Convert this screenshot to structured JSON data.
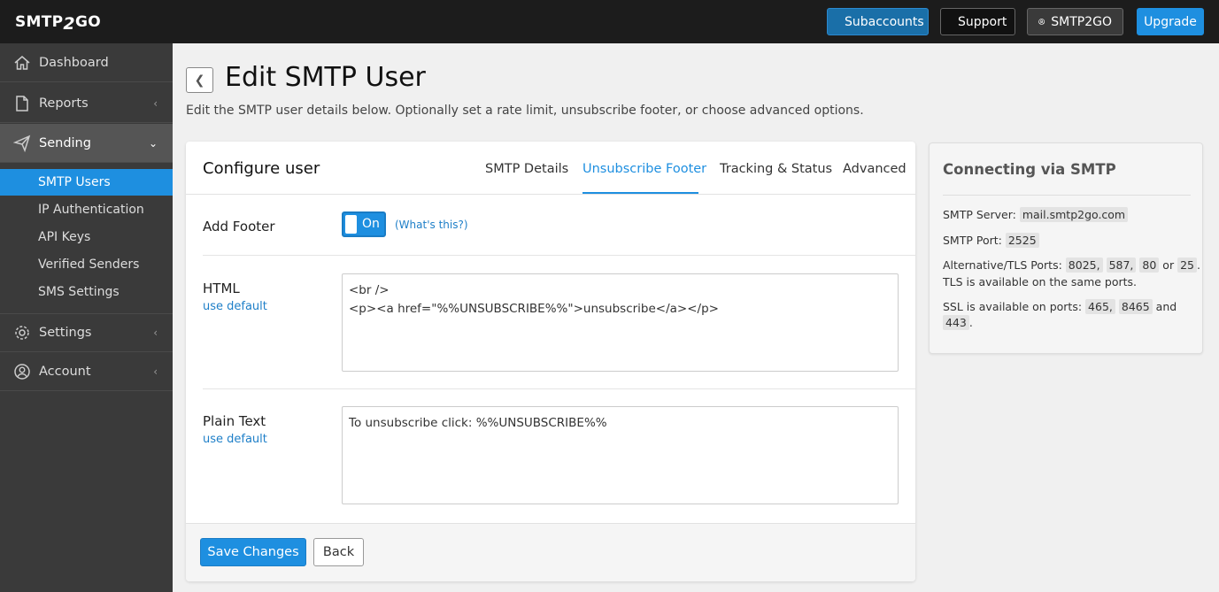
{
  "app": {
    "logo_prefix": "SMTP",
    "logo_two": "2",
    "logo_suffix": "GO"
  },
  "topbar": {
    "subaccounts": "Subaccounts",
    "support": "Support",
    "account": "SMTP2GO",
    "upgrade": "Upgrade"
  },
  "sidebar": {
    "dashboard": "Dashboard",
    "reports": "Reports",
    "sending": "Sending",
    "sending_sub": [
      "SMTP Users",
      "IP Authentication",
      "API Keys",
      "Verified Senders",
      "SMS Settings"
    ],
    "settings": "Settings",
    "account": "Account"
  },
  "page": {
    "title": "Edit SMTP User",
    "subtitle": "Edit the SMTP user details below. Optionally set a rate limit, unsubscribe footer, or choose advanced options."
  },
  "card": {
    "title": "Configure user",
    "tabs": [
      "SMTP Details",
      "Unsubscribe Footer",
      "Tracking & Status",
      "Advanced"
    ],
    "active_tab": "Unsubscribe Footer",
    "add_footer_label": "Add Footer",
    "toggle_label": "On",
    "whats_this": "(What's this?)",
    "html_label": "HTML",
    "use_default": "use default",
    "html_value": "<br />\n<p><a href=\"%%UNSUBSCRIBE%%\">unsubscribe</a></p>",
    "plain_label": "Plain Text",
    "plain_value": "To unsubscribe click: %%UNSUBSCRIBE%%",
    "save_label": "Save Changes",
    "back_label": "Back"
  },
  "smtp_info": {
    "title": "Connecting via SMTP",
    "server_label": "SMTP Server:",
    "server": "mail.smtp2go.com",
    "port_label": "SMTP Port:",
    "port": "2525",
    "alt_label": "Alternative/TLS Ports:",
    "alt_ports": [
      "8025,",
      "587,",
      "80"
    ],
    "alt_or": "or",
    "alt_last": "25",
    "tls_note": "TLS is available on the same ports.",
    "ssl_label": "SSL is available on ports:",
    "ssl_ports": [
      "465,",
      "8465"
    ],
    "ssl_and": "and",
    "ssl_last": "443"
  },
  "colors": {
    "accent": "#1e8fe0",
    "topbar": "#1c1c1c",
    "sidebar": "#3a3a3a"
  }
}
